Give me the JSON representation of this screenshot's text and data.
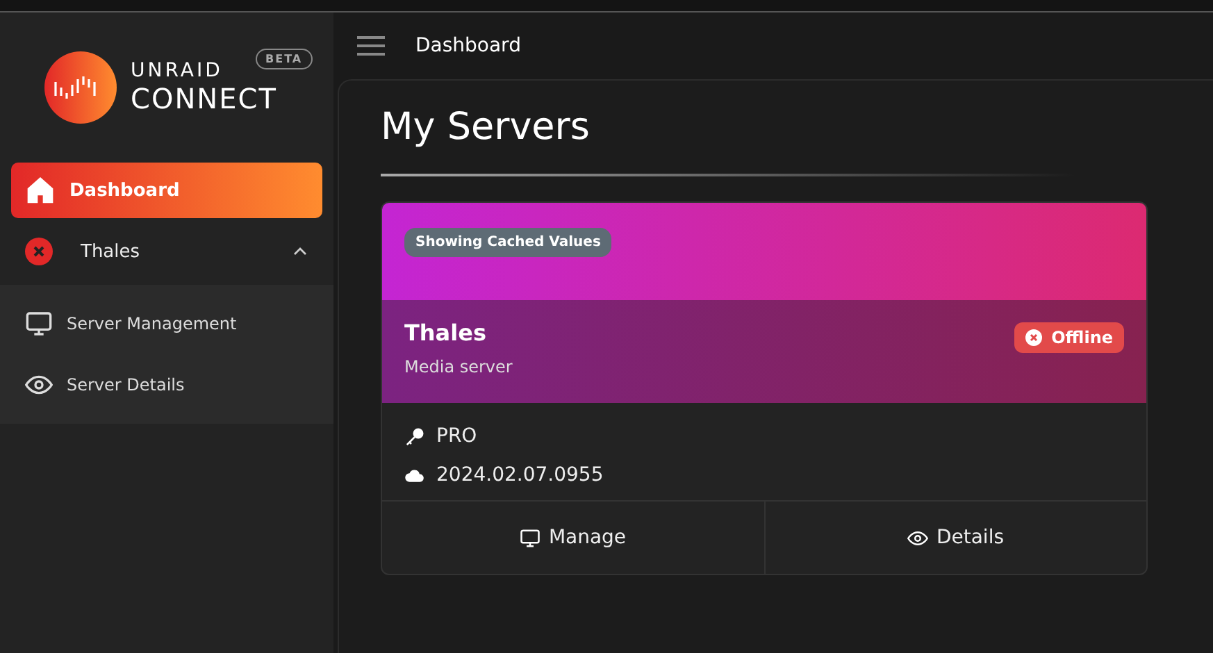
{
  "logo": {
    "line_1": "UNRAID",
    "line_2": "CONNECT",
    "badge": "BETA"
  },
  "sidebar": {
    "items": [
      {
        "label": "Dashboard",
        "kind": "home",
        "selected": true
      },
      {
        "label": "Thales",
        "kind": "server",
        "expanded": true,
        "children": [
          {
            "label": "Server Management",
            "kind": "monitor",
            "selected": false
          },
          {
            "label": "Server Details",
            "kind": "eye",
            "selected": false
          }
        ]
      }
    ]
  },
  "header": {
    "title": "Dashboard"
  },
  "page": {
    "title": "My Servers"
  },
  "servers": [
    {
      "badge": "Showing Cached Values",
      "name": "Thales",
      "description": "Media server",
      "status": "Offline",
      "online": false,
      "details": [
        {
          "kind": "key",
          "text": "PRO"
        },
        {
          "kind": "cloud",
          "text": "2024.02.07.0955"
        }
      ],
      "actions": [
        {
          "kind": "monitor",
          "label": "Manage"
        },
        {
          "kind": "eye",
          "label": "Details"
        }
      ]
    }
  ]
}
